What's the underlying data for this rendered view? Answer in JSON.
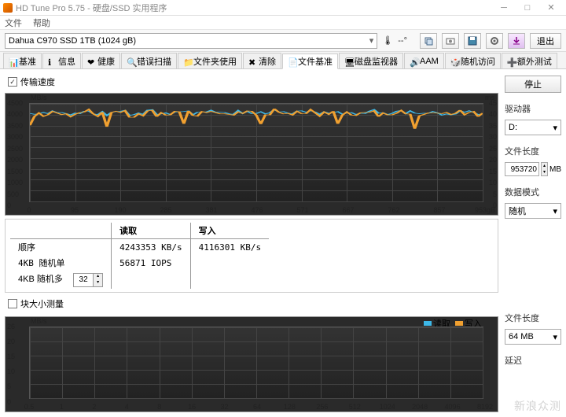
{
  "window": {
    "title": "HD Tune Pro 5.75 - 硬盘/SSD 实用程序"
  },
  "menu": {
    "file": "文件",
    "help": "帮助"
  },
  "toolbar": {
    "drive": "Dahua C970 SSD 1TB (1024 gB)",
    "temp": "--°",
    "exit": "退出"
  },
  "tabs": [
    {
      "label": "基准"
    },
    {
      "label": "信息"
    },
    {
      "label": "健康"
    },
    {
      "label": "错误扫描"
    },
    {
      "label": "文件夹使用"
    },
    {
      "label": "清除"
    },
    {
      "label": "文件基准"
    },
    {
      "label": "磁盘监视器"
    },
    {
      "label": "AAM"
    },
    {
      "label": "随机访问"
    },
    {
      "label": "额外测试"
    }
  ],
  "active_tab": 6,
  "transfer": {
    "checkbox_label": "传输速度",
    "checked": true,
    "unit_left": "MB/s",
    "unit_right": "ms",
    "y_left": [
      4500,
      4000,
      3500,
      3000,
      2500,
      2000,
      1500,
      1000,
      500,
      0
    ],
    "y_right": [
      45,
      40,
      35,
      30,
      25,
      20,
      15,
      10,
      5,
      0
    ],
    "x": [
      0,
      95,
      190,
      285,
      381,
      476,
      571,
      667,
      762,
      857,
      "953gB"
    ],
    "results": {
      "col_read": "读取",
      "col_write": "写入",
      "row_seq": "顺序",
      "row_4kb_single": "4KB 随机单",
      "row_4kb_multi": "4KB 随机多",
      "seq_read": "4243353 KB/s",
      "seq_write": "4116301 KB/s",
      "iops_4kb": "56871 IOPS",
      "multi_value": "32"
    }
  },
  "blocksize": {
    "checkbox_label": "块大小测量",
    "checked": false,
    "unit_left": "MB/s",
    "legend_read": "读取",
    "legend_write": "写入",
    "y_left": [
      26,
      20,
      15,
      10,
      5,
      0
    ],
    "x": [
      "0.5",
      1,
      2,
      4,
      8,
      16,
      32,
      64,
      128,
      256,
      512,
      1024,
      2048,
      4096,
      8192
    ]
  },
  "side": {
    "stop": "停止",
    "drive_label": "驱动器",
    "drive_value": "D:",
    "filelen_label": "文件长度",
    "filelen_value": "953720",
    "filelen_unit": "MB",
    "datamode_label": "数据模式",
    "datamode_value": "随机",
    "filelen2_label": "文件长度",
    "filelen2_value": "64 MB",
    "delay_label": "延迟"
  },
  "chart_data": {
    "type": "line",
    "title": "传输速度",
    "xlabel": "gB",
    "ylabel": "MB/s",
    "xlim": [
      0,
      953
    ],
    "ylim": [
      0,
      4500
    ],
    "series": [
      {
        "name": "读取",
        "color": "#3db8e8",
        "approx_mean": 4100,
        "approx_range": [
          3800,
          4300
        ]
      },
      {
        "name": "写入",
        "color": "#f0a030",
        "approx_mean": 4050,
        "approx_range": [
          3400,
          4250
        ]
      }
    ],
    "note": "Both read and write throughput hover near ~4000–4200 MB/s across the full 0–953 gB span; write (orange) shows occasional dips to ~3400–3600 MB/s."
  },
  "watermark": "新浪众测"
}
